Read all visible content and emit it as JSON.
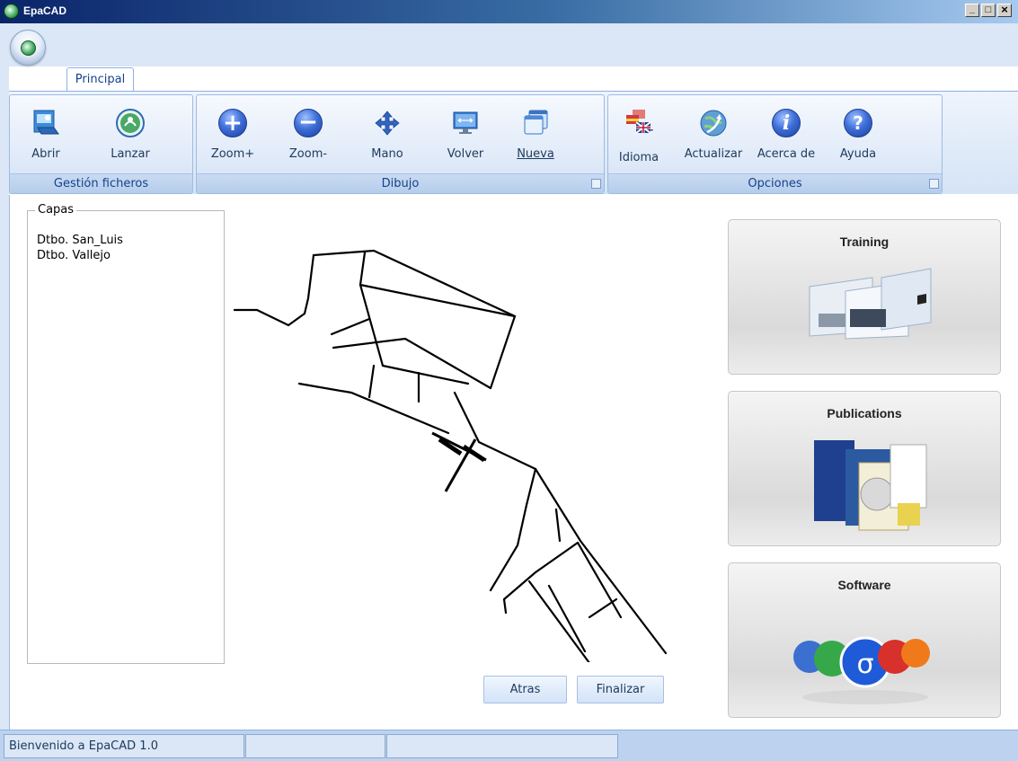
{
  "window": {
    "title": "EpaCAD",
    "minimize_label": "_",
    "maximize_label": "□",
    "close_label": "×"
  },
  "ribbon": {
    "tabs": [
      {
        "label": "Principal"
      }
    ],
    "groups": {
      "files": {
        "label": "Gestión ficheros",
        "buttons": {
          "open": "Abrir",
          "launch": "Lanzar"
        }
      },
      "drawing": {
        "label": "Dibujo",
        "buttons": {
          "zoom_in": "Zoom+",
          "zoom_out": "Zoom-",
          "pan": "Mano",
          "back": "Volver",
          "new": "Nueva"
        }
      },
      "options": {
        "label": "Opciones",
        "buttons": {
          "language": "Idioma",
          "update": "Actualizar",
          "about": "Acerca de",
          "help": "Ayuda"
        }
      }
    }
  },
  "layers": {
    "legend": "Capas",
    "items": [
      "Dtbo. San_Luis",
      "Dtbo. Vallejo"
    ]
  },
  "actions": {
    "back": "Atras",
    "finish": "Finalizar"
  },
  "cards": [
    {
      "title": "Training"
    },
    {
      "title": "Publications"
    },
    {
      "title": "Software"
    }
  ],
  "status": {
    "message": "Bienvenido a EpaCAD 1.0",
    "cell2": "",
    "cell3": ""
  },
  "colors": {
    "accent": "#15428b",
    "ribbon_bg": "#dbe7f6",
    "title_bar": "#0a246a"
  }
}
